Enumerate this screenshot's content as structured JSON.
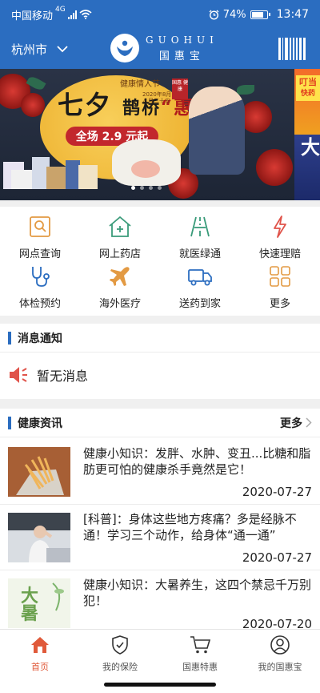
{
  "status_bar": {
    "carrier": "中国移动",
    "network": "4G",
    "battery": "74%",
    "time": "13:47"
  },
  "header": {
    "city": "杭州市",
    "logo_en": "GUOHUI",
    "logo_cn": "国惠宝",
    "scan_icon": "barcode-icon"
  },
  "banner": {
    "title_prefix": "七夕",
    "title_mid": "鹊桥",
    "title_hui": "“惠”",
    "subtitle": "健康情人节",
    "subtitle2": "2020年8月 八月二十五",
    "badge": "国惠 健康",
    "price_pill": "全场 2.9 元起",
    "next_tag_1": "叮当",
    "next_tag_2": "快药",
    "next_big": "大",
    "dots": 4,
    "active_dot": 0
  },
  "quick_services": [
    {
      "label": "网点查询",
      "icon": "search-icon",
      "color": "#e39a43"
    },
    {
      "label": "网上药店",
      "icon": "pharmacy-icon",
      "color": "#3a9b7a"
    },
    {
      "label": "就医绿通",
      "icon": "road-icon",
      "color": "#3a9b7a"
    },
    {
      "label": "快速理赔",
      "icon": "lightning-icon",
      "color": "#e0534a"
    },
    {
      "label": "体检预约",
      "icon": "stethoscope-icon",
      "color": "#2b6dc0"
    },
    {
      "label": "海外医疗",
      "icon": "airplane-icon",
      "color": "#e39a43"
    },
    {
      "label": "送药到家",
      "icon": "truck-icon",
      "color": "#2b6dc0"
    },
    {
      "label": "更多",
      "icon": "grid-icon",
      "color": "#e39a43"
    }
  ],
  "notice": {
    "heading": "消息通知",
    "message": "暂无消息",
    "icon": "speaker-icon"
  },
  "news": {
    "heading": "健康资讯",
    "more_label": "更多",
    "items": [
      {
        "title": "健康小知识：发胖、水肿、变丑...比糖和脂肪更可怕的健康杀手竟然是它！",
        "date": "2020-07-27"
      },
      {
        "title": "[科普]：身体这些地方疼痛？多是经脉不通！学习三个动作，给身体“通一通”",
        "date": "2020-07-27"
      },
      {
        "title": "健康小知识：大暑养生，这四个禁忌千万别犯！",
        "date": "2020-07-20",
        "thumb_text": "大暑"
      }
    ]
  },
  "tabbar": {
    "active": 0,
    "items": [
      {
        "label": "首页",
        "icon": "home-icon"
      },
      {
        "label": "我的保险",
        "icon": "shield-icon"
      },
      {
        "label": "国惠特惠",
        "icon": "cart-icon"
      },
      {
        "label": "我的国惠宝",
        "icon": "user-icon"
      }
    ]
  },
  "colors": {
    "brand_blue": "#2b6dc0",
    "accent_red": "#e05a3a"
  }
}
